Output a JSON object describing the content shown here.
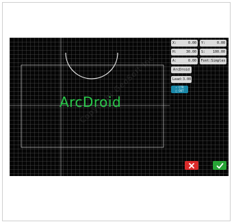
{
  "canvas": {
    "text_object": "ArcDroid",
    "watermark": "Copyright GeoSoft Inc"
  },
  "panel": {
    "x_label": "X:",
    "x_value": "0.00",
    "y_label": "Y:",
    "y_value": "0.00",
    "h_label": "H:",
    "h_value": "30.00",
    "s_label": "S:",
    "s_value": "100.00",
    "a_label": "A:",
    "a_value": "0.00",
    "font_label": "Font:Simplex",
    "text_button": "ArcDroid",
    "lead_label": "Lead:",
    "lead_value": "3.00",
    "toggle_line1": "✓ CTR",
    "toggle_line2": "□ OUT"
  },
  "icons": {
    "cancel": "close-icon",
    "confirm": "check-icon"
  },
  "colors": {
    "canvas_bg": "#050505",
    "text_green": "#29c84a",
    "cancel_red": "#d92b2b",
    "ok_green": "#27a436",
    "toggle_blue": "#1a88a8"
  }
}
